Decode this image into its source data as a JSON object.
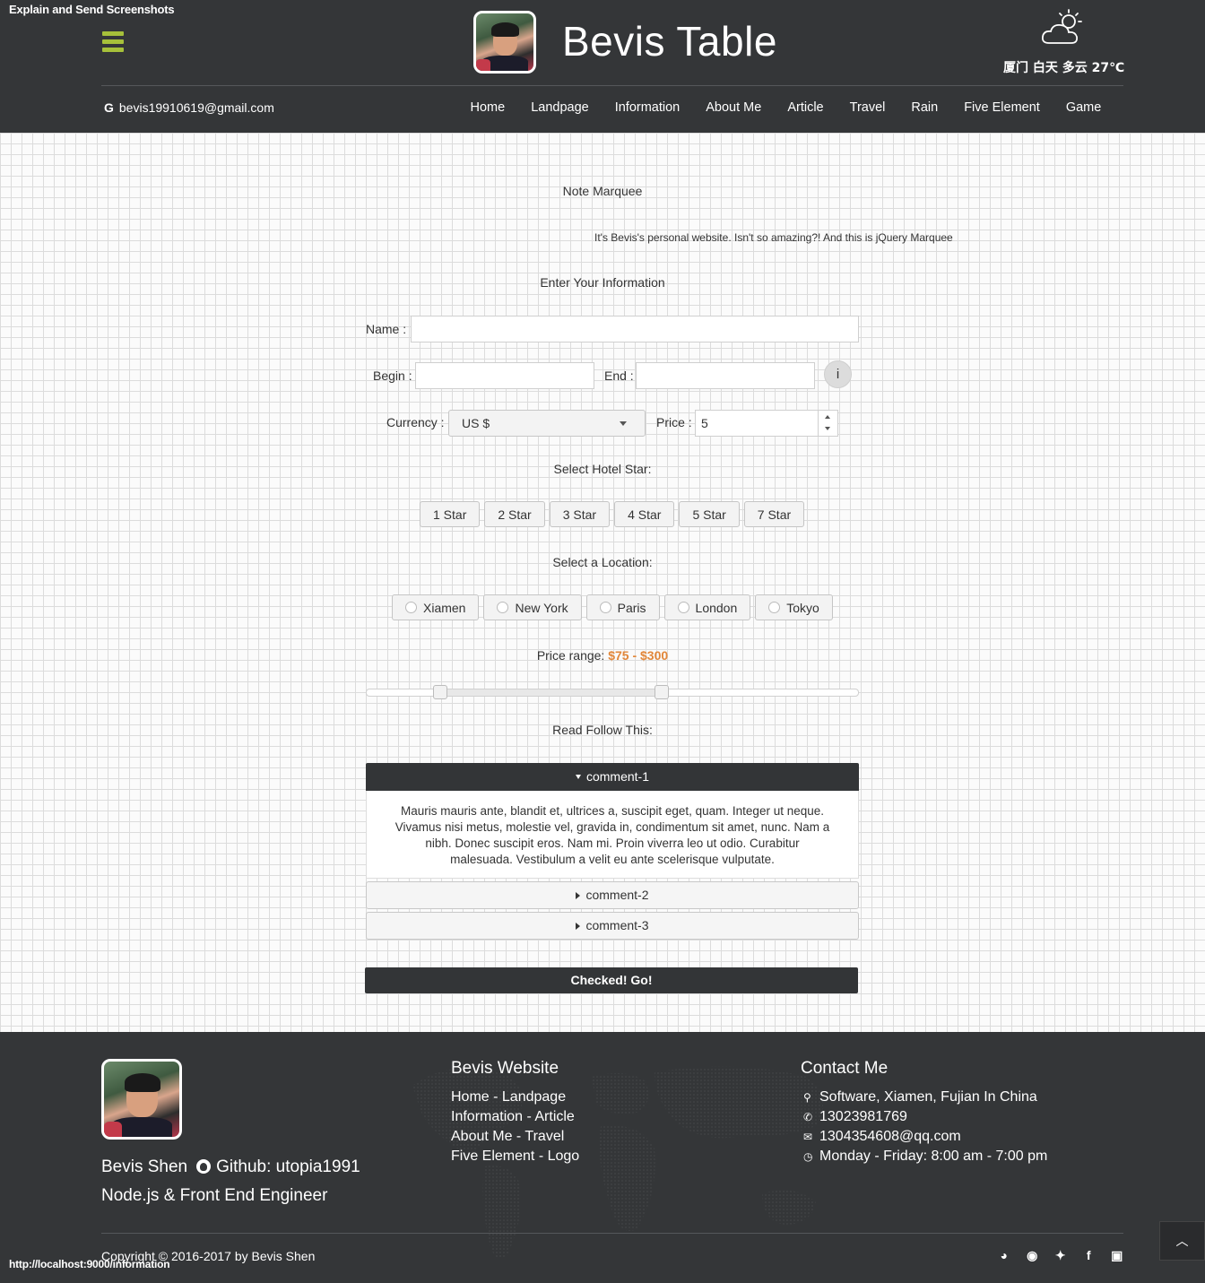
{
  "app": {
    "explain_link": "Explain and Send Screenshots",
    "status_url": "http://localhost:9000/information"
  },
  "header": {
    "title": "Bevis Table",
    "weather": "厦门 白天 多云 27℃",
    "email": "bevis19910619@gmail.com",
    "nav": [
      "Home",
      "Landpage",
      "Information",
      "About Me",
      "Article",
      "Travel",
      "Rain",
      "Five Element",
      "Game"
    ]
  },
  "form": {
    "marquee_label": "Note Marquee",
    "marquee_text": "It's Bevis's personal website. Isn't so amazing?! And this is jQuery Marquee",
    "info_heading": "Enter Your Information",
    "name_label": "Name :",
    "name_value": "",
    "begin_label": "Begin :",
    "begin_value": "",
    "end_label": "End :",
    "end_value": "",
    "info_button": "i",
    "currency_label": "Currency :",
    "currency_value": "US $",
    "price_label": "Price :",
    "price_value": "5",
    "hotel_heading": "Select Hotel Star:",
    "stars": [
      "1 Star",
      "2 Star",
      "3 Star",
      "4 Star",
      "5 Star",
      "7 Star"
    ],
    "location_heading": "Select a Location:",
    "locations": [
      "Xiamen",
      "New York",
      "Paris",
      "London",
      "Tokyo"
    ],
    "price_range_label": "Price range:",
    "price_range_value": "$75 - $300",
    "slider": {
      "min_fraction": 0.15,
      "max_fraction": 0.6
    },
    "read_heading": "Read Follow This:",
    "accordion": [
      {
        "title": "comment-1",
        "body": "Mauris mauris ante, blandit et, ultrices a, suscipit eget, quam. Integer ut neque. Vivamus nisi metus, molestie vel, gravida in, condimentum sit amet, nunc. Nam a nibh. Donec suscipit eros. Nam mi. Proin viverra leo ut odio. Curabitur malesuada. Vestibulum a velit eu ante scelerisque vulputate."
      },
      {
        "title": "comment-2"
      },
      {
        "title": "comment-3"
      }
    ],
    "submit": "Checked! Go!"
  },
  "footer": {
    "name": "Bevis Shen",
    "github": "Github: utopia1991",
    "role": "Node.js & Front End Engineer",
    "website_title": "Bevis Website",
    "website_links": [
      "Home - Landpage",
      "Information - Article",
      "About Me - Travel",
      "Five Element - Logo"
    ],
    "contact_title": "Contact Me",
    "contact": {
      "address": "Software, Xiamen, Fujian In China",
      "phone": "13023981769",
      "email": "1304354608@qq.com",
      "hours": "Monday - Friday: 8:00 am - 7:00 pm"
    },
    "copyright": "Copyright © 2016-2017 by Bevis Shen",
    "social_icons": [
      "wechat-icon",
      "weibo-icon",
      "twitter-icon",
      "facebook-icon",
      "instagram-icon"
    ]
  },
  "colors": {
    "header_bg": "#343638",
    "accent_green": "#a6c03a",
    "price_orange": "#e2873a"
  }
}
